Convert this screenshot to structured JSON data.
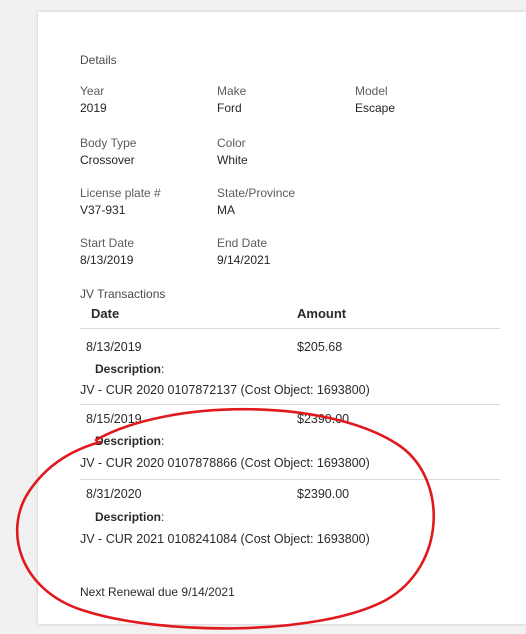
{
  "details": {
    "title": "Details",
    "fields": {
      "year": {
        "label": "Year",
        "value": "2019"
      },
      "make": {
        "label": "Make",
        "value": "Ford"
      },
      "model": {
        "label": "Model",
        "value": "Escape"
      },
      "body_type": {
        "label": "Body Type",
        "value": "Crossover"
      },
      "color": {
        "label": "Color",
        "value": "White"
      },
      "license_plate": {
        "label": "License plate #",
        "value": "V37-931"
      },
      "state_province": {
        "label": "State/Province",
        "value": "MA"
      },
      "start_date": {
        "label": "Start Date",
        "value": "8/13/2019"
      },
      "end_date": {
        "label": "End Date",
        "value": "9/14/2021"
      }
    }
  },
  "transactions": {
    "title": "JV Transactions",
    "headers": {
      "date": "Date",
      "amount": "Amount"
    },
    "description_label": "Description",
    "description_colon": ":",
    "rows": [
      {
        "date": "8/13/2019",
        "amount": "$205.68",
        "description": "JV - CUR 2020 0107872137 (Cost Object: 1693800)"
      },
      {
        "date": "8/15/2019",
        "amount": "$2390.00",
        "description": "JV - CUR 2020 0107878866 (Cost Object: 1693800)"
      },
      {
        "date": "8/31/2020",
        "amount": "$2390.00",
        "description": "JV - CUR 2021 0108241084 (Cost Object: 1693800)"
      }
    ]
  },
  "footer": {
    "renewal": "Next Renewal due 9/14/2021"
  },
  "colors": {
    "annotation": "#e0191e",
    "card": "#ffffff",
    "background": "#f1f1f1"
  }
}
